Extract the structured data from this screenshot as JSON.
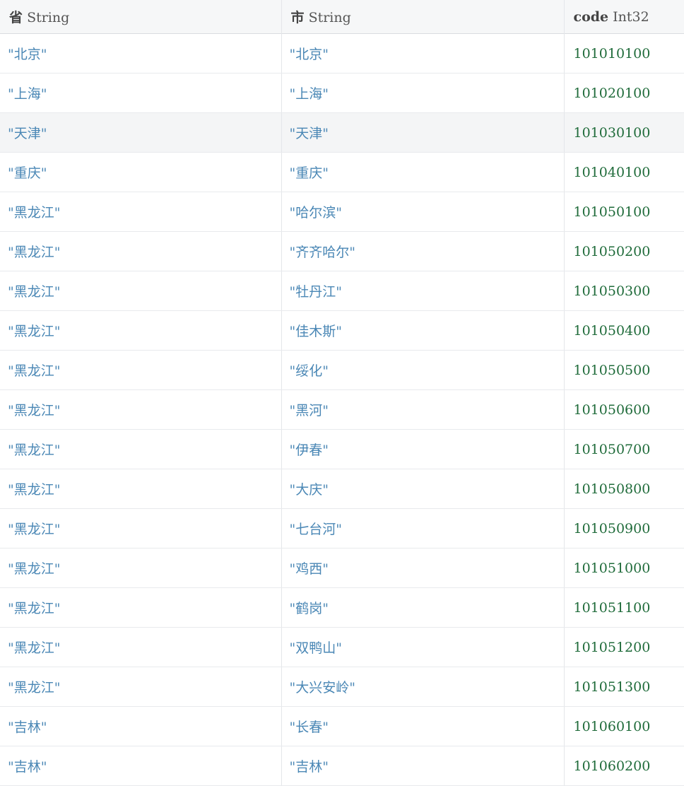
{
  "columns": [
    {
      "name": "省",
      "type": "String"
    },
    {
      "name": "市",
      "type": "String"
    },
    {
      "name": "code",
      "type": "Int32"
    }
  ],
  "highlighted_row": 2,
  "rows": [
    {
      "province": "\"北京\"",
      "city": "\"北京\"",
      "code": "101010100"
    },
    {
      "province": "\"上海\"",
      "city": "\"上海\"",
      "code": "101020100"
    },
    {
      "province": "\"天津\"",
      "city": "\"天津\"",
      "code": "101030100"
    },
    {
      "province": "\"重庆\"",
      "city": "\"重庆\"",
      "code": "101040100"
    },
    {
      "province": "\"黑龙江\"",
      "city": "\"哈尔滨\"",
      "code": "101050100"
    },
    {
      "province": "\"黑龙江\"",
      "city": "\"齐齐哈尔\"",
      "code": "101050200"
    },
    {
      "province": "\"黑龙江\"",
      "city": "\"牡丹江\"",
      "code": "101050300"
    },
    {
      "province": "\"黑龙江\"",
      "city": "\"佳木斯\"",
      "code": "101050400"
    },
    {
      "province": "\"黑龙江\"",
      "city": "\"绥化\"",
      "code": "101050500"
    },
    {
      "province": "\"黑龙江\"",
      "city": "\"黑河\"",
      "code": "101050600"
    },
    {
      "province": "\"黑龙江\"",
      "city": "\"伊春\"",
      "code": "101050700"
    },
    {
      "province": "\"黑龙江\"",
      "city": "\"大庆\"",
      "code": "101050800"
    },
    {
      "province": "\"黑龙江\"",
      "city": "\"七台河\"",
      "code": "101050900"
    },
    {
      "province": "\"黑龙江\"",
      "city": "\"鸡西\"",
      "code": "101051000"
    },
    {
      "province": "\"黑龙江\"",
      "city": "\"鹤岗\"",
      "code": "101051100"
    },
    {
      "province": "\"黑龙江\"",
      "city": "\"双鸭山\"",
      "code": "101051200"
    },
    {
      "province": "\"黑龙江\"",
      "city": "\"大兴安岭\"",
      "code": "101051300"
    },
    {
      "province": "\"吉林\"",
      "city": "\"长春\"",
      "code": "101060100"
    },
    {
      "province": "\"吉林\"",
      "city": "\"吉林\"",
      "code": "101060200"
    }
  ]
}
